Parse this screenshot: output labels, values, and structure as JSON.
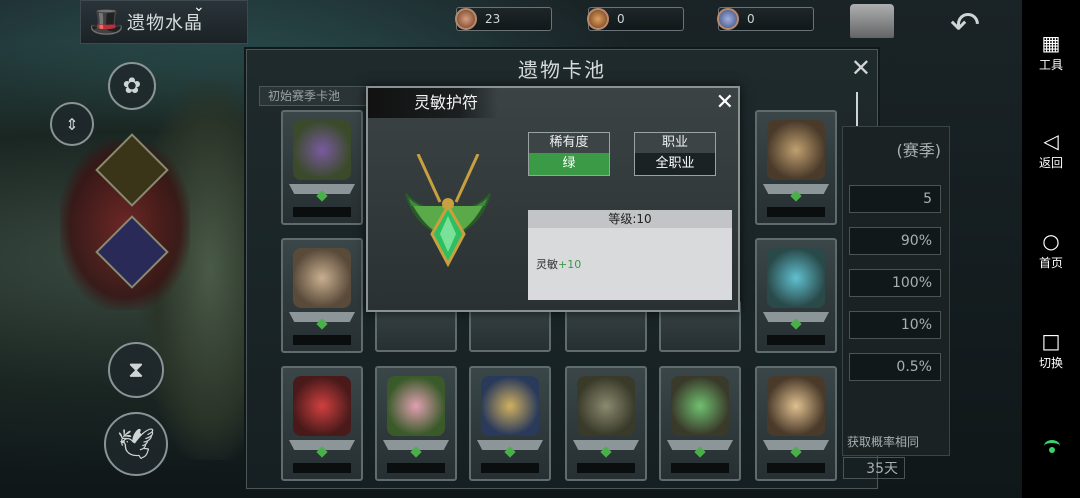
{
  "crystal_bar": {
    "title": "遗物水晶"
  },
  "resources": [
    {
      "name": "currency-1",
      "value": "23"
    },
    {
      "name": "currency-2",
      "value": "0"
    },
    {
      "name": "currency-3",
      "value": "0"
    }
  ],
  "card_pool": {
    "title": "遗物卡池",
    "tab": "初始赛季卡池",
    "close": "✕"
  },
  "info_behind": {
    "header": "(赛季)",
    "rows": [
      "5",
      "90%",
      "100%",
      "10%",
      "0.5%"
    ],
    "note": "获取概率相同",
    "days": "35天"
  },
  "popup": {
    "title": "灵敏护符",
    "close": "✕",
    "rarity_label": "稀有度",
    "rarity_value": "绿",
    "class_label": "职业",
    "class_value": "全职业",
    "level_text": "等级:10",
    "stat_name": "灵敏",
    "stat_bonus": "+10"
  },
  "nav": {
    "tools": "工具",
    "back": "返回",
    "home": "首页",
    "switch": "切换"
  },
  "colors": {
    "rarity_green": "#3a9a46",
    "nav_bg": "#000000",
    "wifi": "#3ad36a"
  }
}
